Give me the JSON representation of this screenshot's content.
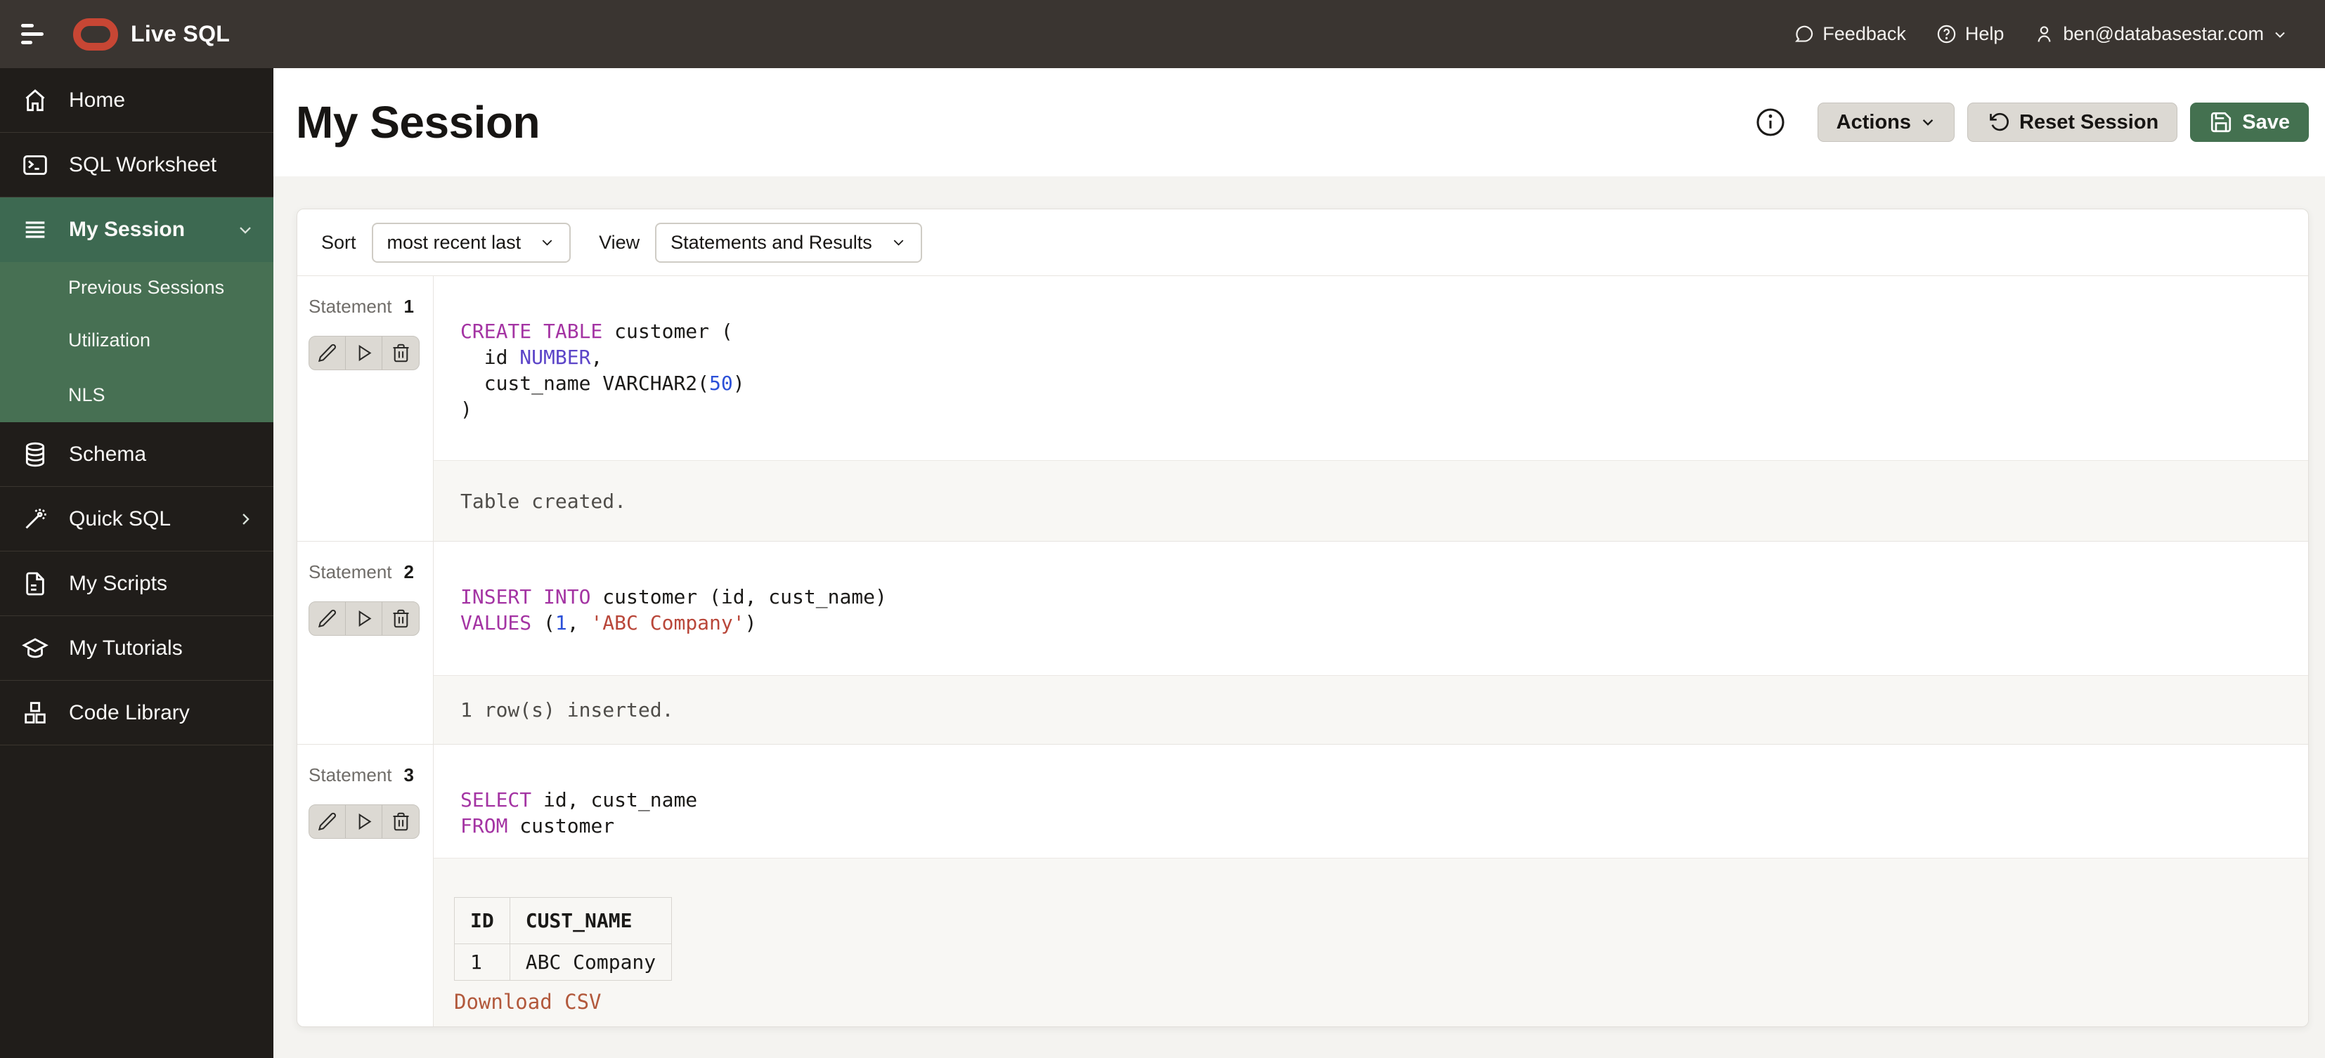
{
  "topbar": {
    "brand": "Live SQL",
    "feedback": "Feedback",
    "help": "Help",
    "user_email": "ben@databasestar.com"
  },
  "sidebar": {
    "items": [
      {
        "label": "Home",
        "icon": "home-icon"
      },
      {
        "label": "SQL Worksheet",
        "icon": "terminal-icon"
      },
      {
        "label": "My Session",
        "icon": "list-icon",
        "active": true,
        "chevron": "down"
      },
      {
        "label": "Schema",
        "icon": "database-icon"
      },
      {
        "label": "Quick SQL",
        "icon": "wand-icon",
        "chevron": "right"
      },
      {
        "label": "My Scripts",
        "icon": "document-icon"
      },
      {
        "label": "My Tutorials",
        "icon": "graduation-cap-icon"
      },
      {
        "label": "Code Library",
        "icon": "blocks-icon"
      }
    ],
    "session_subitems": [
      {
        "label": "Previous Sessions"
      },
      {
        "label": "Utilization"
      },
      {
        "label": "NLS"
      }
    ]
  },
  "header": {
    "title": "My Session",
    "actions_label": "Actions",
    "reset_label": "Reset Session",
    "save_label": "Save"
  },
  "controls": {
    "sort_label": "Sort",
    "sort_value": "most recent last",
    "view_label": "View",
    "view_value": "Statements and Results"
  },
  "statements": [
    {
      "label": "Statement",
      "number": "1",
      "code": [
        [
          {
            "t": "kw",
            "v": "CREATE TABLE"
          },
          {
            "t": "pl",
            "v": " customer ("
          }
        ],
        [
          {
            "t": "pl",
            "v": "  id "
          },
          {
            "t": "ty",
            "v": "NUMBER"
          },
          {
            "t": "pl",
            "v": ","
          }
        ],
        [
          {
            "t": "pl",
            "v": "  cust_name VARCHAR2("
          },
          {
            "t": "num",
            "v": "50"
          },
          {
            "t": "pl",
            "v": ")"
          }
        ],
        [
          {
            "t": "pl",
            "v": ")"
          }
        ]
      ],
      "result_text": "Table created."
    },
    {
      "label": "Statement",
      "number": "2",
      "code": [
        [
          {
            "t": "kw",
            "v": "INSERT INTO"
          },
          {
            "t": "pl",
            "v": " customer (id, cust_name)"
          }
        ],
        [
          {
            "t": "kw",
            "v": "VALUES"
          },
          {
            "t": "pl",
            "v": " ("
          },
          {
            "t": "num",
            "v": "1"
          },
          {
            "t": "pl",
            "v": ", "
          },
          {
            "t": "str",
            "v": "'ABC Company'"
          },
          {
            "t": "pl",
            "v": ")"
          }
        ]
      ],
      "result_text": "1 row(s) inserted."
    },
    {
      "label": "Statement",
      "number": "3",
      "code": [
        [
          {
            "t": "kw",
            "v": "SELECT"
          },
          {
            "t": "pl",
            "v": " id, cust_name"
          }
        ],
        [
          {
            "t": "kw",
            "v": "FROM"
          },
          {
            "t": "pl",
            "v": " customer"
          }
        ]
      ],
      "result_table": {
        "headers": [
          "ID",
          "CUST_NAME"
        ],
        "rows": [
          [
            "1",
            "ABC Company"
          ]
        ]
      },
      "download_label": "Download CSV"
    }
  ],
  "icons": {
    "menu-icon": "three horizontal bars",
    "oracle-logo": "red rounded ring",
    "feedback-icon": "speech bubble",
    "help-icon": "question mark in circle",
    "user-icon": "person outline",
    "chevron-down-icon": "v chevron",
    "chevron-right-icon": "> chevron",
    "home-icon": "house",
    "terminal-icon": "prompt window",
    "list-icon": "stacked lines",
    "database-icon": "cylinder stack",
    "wand-icon": "magic wand",
    "document-icon": "file with lines",
    "graduation-cap-icon": "mortarboard",
    "blocks-icon": "stacked cubes",
    "info-icon": "i in circle",
    "reset-icon": "counterclockwise arrow",
    "save-icon": "floppy disk",
    "edit-icon": "pencil",
    "run-icon": "play triangle",
    "delete-icon": "trash can"
  },
  "colors": {
    "accent": "#447150",
    "brand": "#c74634",
    "sidebar_active": "#3d6951",
    "sidebar_submenu": "#477053",
    "keyword": "#a434a3",
    "datatype": "#5b44c8",
    "number": "#2b50d8",
    "string": "#b9473a",
    "link": "#b2593c"
  }
}
